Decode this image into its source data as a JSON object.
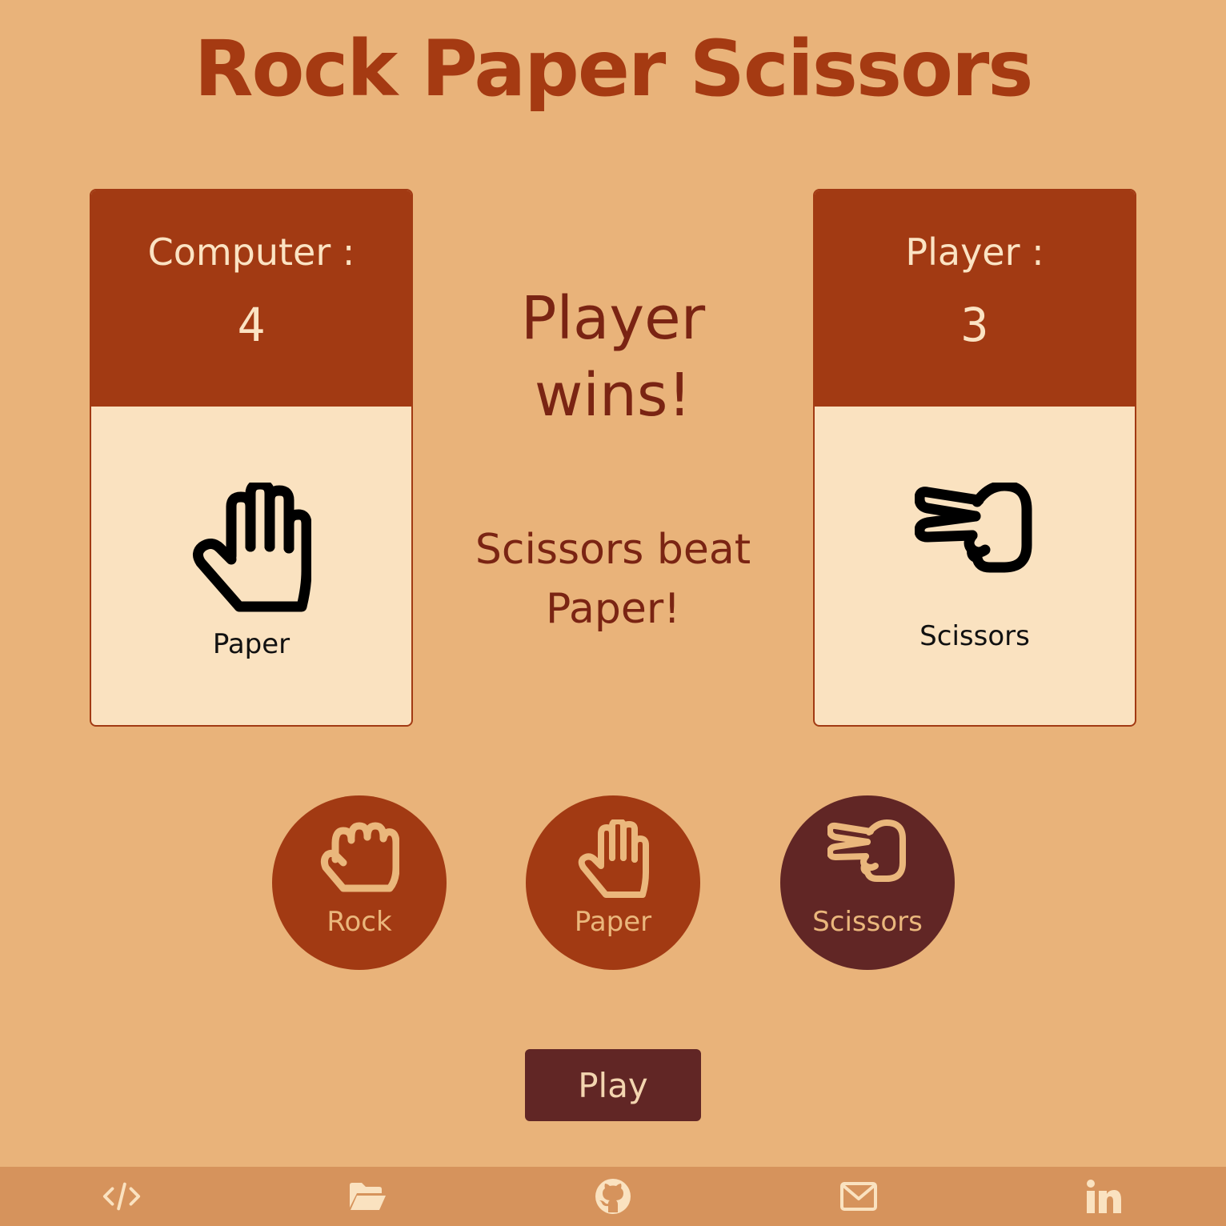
{
  "title": "Rock Paper Scissors",
  "computer": {
    "label": "Computer :",
    "score": "4",
    "choice_label": "Paper",
    "choice_icon": "paper-hand-icon"
  },
  "player": {
    "label": "Player :",
    "score": "3",
    "choice_label": "Scissors",
    "choice_icon": "scissors-hand-icon"
  },
  "result": {
    "winner": "Player wins!",
    "detail": "Scissors beat Paper!"
  },
  "choices": [
    {
      "label": "Rock",
      "icon": "rock-fist-icon"
    },
    {
      "label": "Paper",
      "icon": "paper-hand-icon"
    },
    {
      "label": "Scissors",
      "icon": "scissors-hand-icon",
      "selected": true
    }
  ],
  "play_label": "Play",
  "footer": [
    "code-icon",
    "folder-icon",
    "github-icon",
    "mail-icon",
    "linkedin-icon"
  ],
  "colors": {
    "background": "#e9b37a",
    "primary": "#a23a13",
    "dark": "#612625",
    "card": "#fae2c0",
    "footer": "#d6935c"
  }
}
